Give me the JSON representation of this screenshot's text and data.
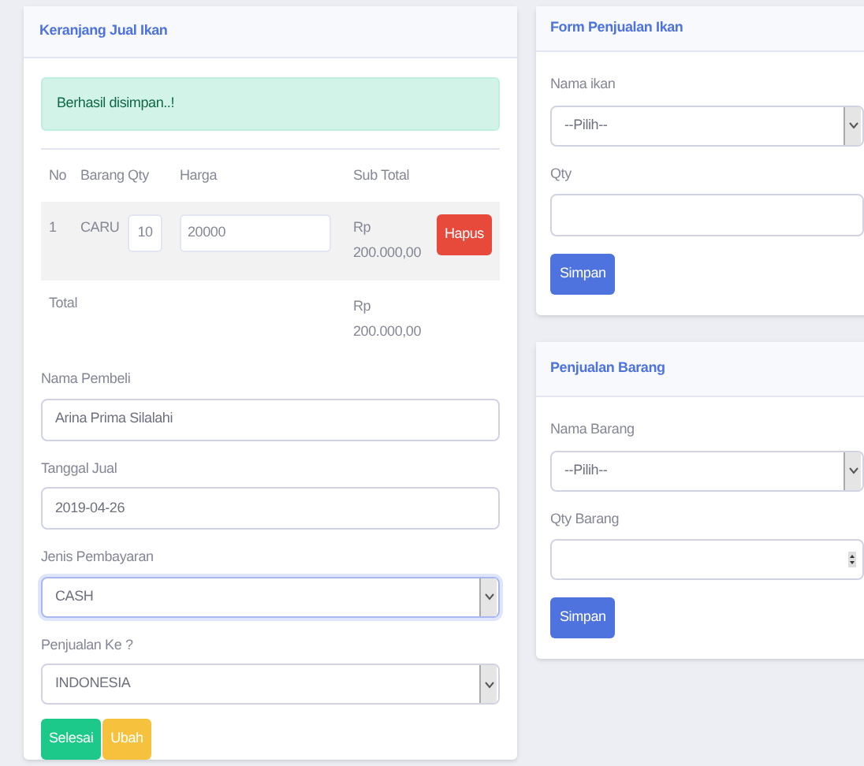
{
  "cart": {
    "title": "Keranjang Jual Ikan",
    "alert": "Berhasil disimpan..!",
    "columns": [
      "No",
      "Barang",
      "Qty",
      "Harga",
      "Sub Total"
    ],
    "rows": [
      {
        "no": "1",
        "item": "CARU",
        "qty": "10",
        "price": "20000",
        "subtotal": "Rp 200.000,00",
        "action": "Hapus"
      }
    ],
    "total": {
      "label": "Total",
      "value": "Rp 200.000,00"
    },
    "fields": [
      {
        "kind": "text",
        "label": "Nama Pembeli",
        "value": "Arina Prima Silalahi",
        "focused": false
      },
      {
        "kind": "text",
        "label": "Tanggal Jual",
        "value": "2019-04-26",
        "focused": false
      },
      {
        "kind": "select",
        "label": "Jenis Pembayaran",
        "value": "CASH",
        "focused": true
      },
      {
        "kind": "select",
        "label": "Penjualan Ke ?",
        "value": "INDONESIA",
        "focused": false
      }
    ],
    "buttons": [
      {
        "label": "Selesai",
        "kind": "success"
      },
      {
        "label": "Ubah",
        "kind": "warning"
      }
    ]
  },
  "forms": [
    {
      "title": "Form Penjualan Ikan",
      "fields": [
        {
          "kind": "select",
          "label": "Nama ikan",
          "value": "--Pilih--"
        },
        {
          "kind": "text",
          "label": "Qty"
        }
      ],
      "button": "Simpan"
    },
    {
      "title": "Penjualan Barang",
      "fields": [
        {
          "kind": "select",
          "label": "Nama Barang",
          "value": "--Pilih--"
        },
        {
          "kind": "number",
          "label": "Qty Barang"
        }
      ],
      "button": "Simpan"
    }
  ]
}
